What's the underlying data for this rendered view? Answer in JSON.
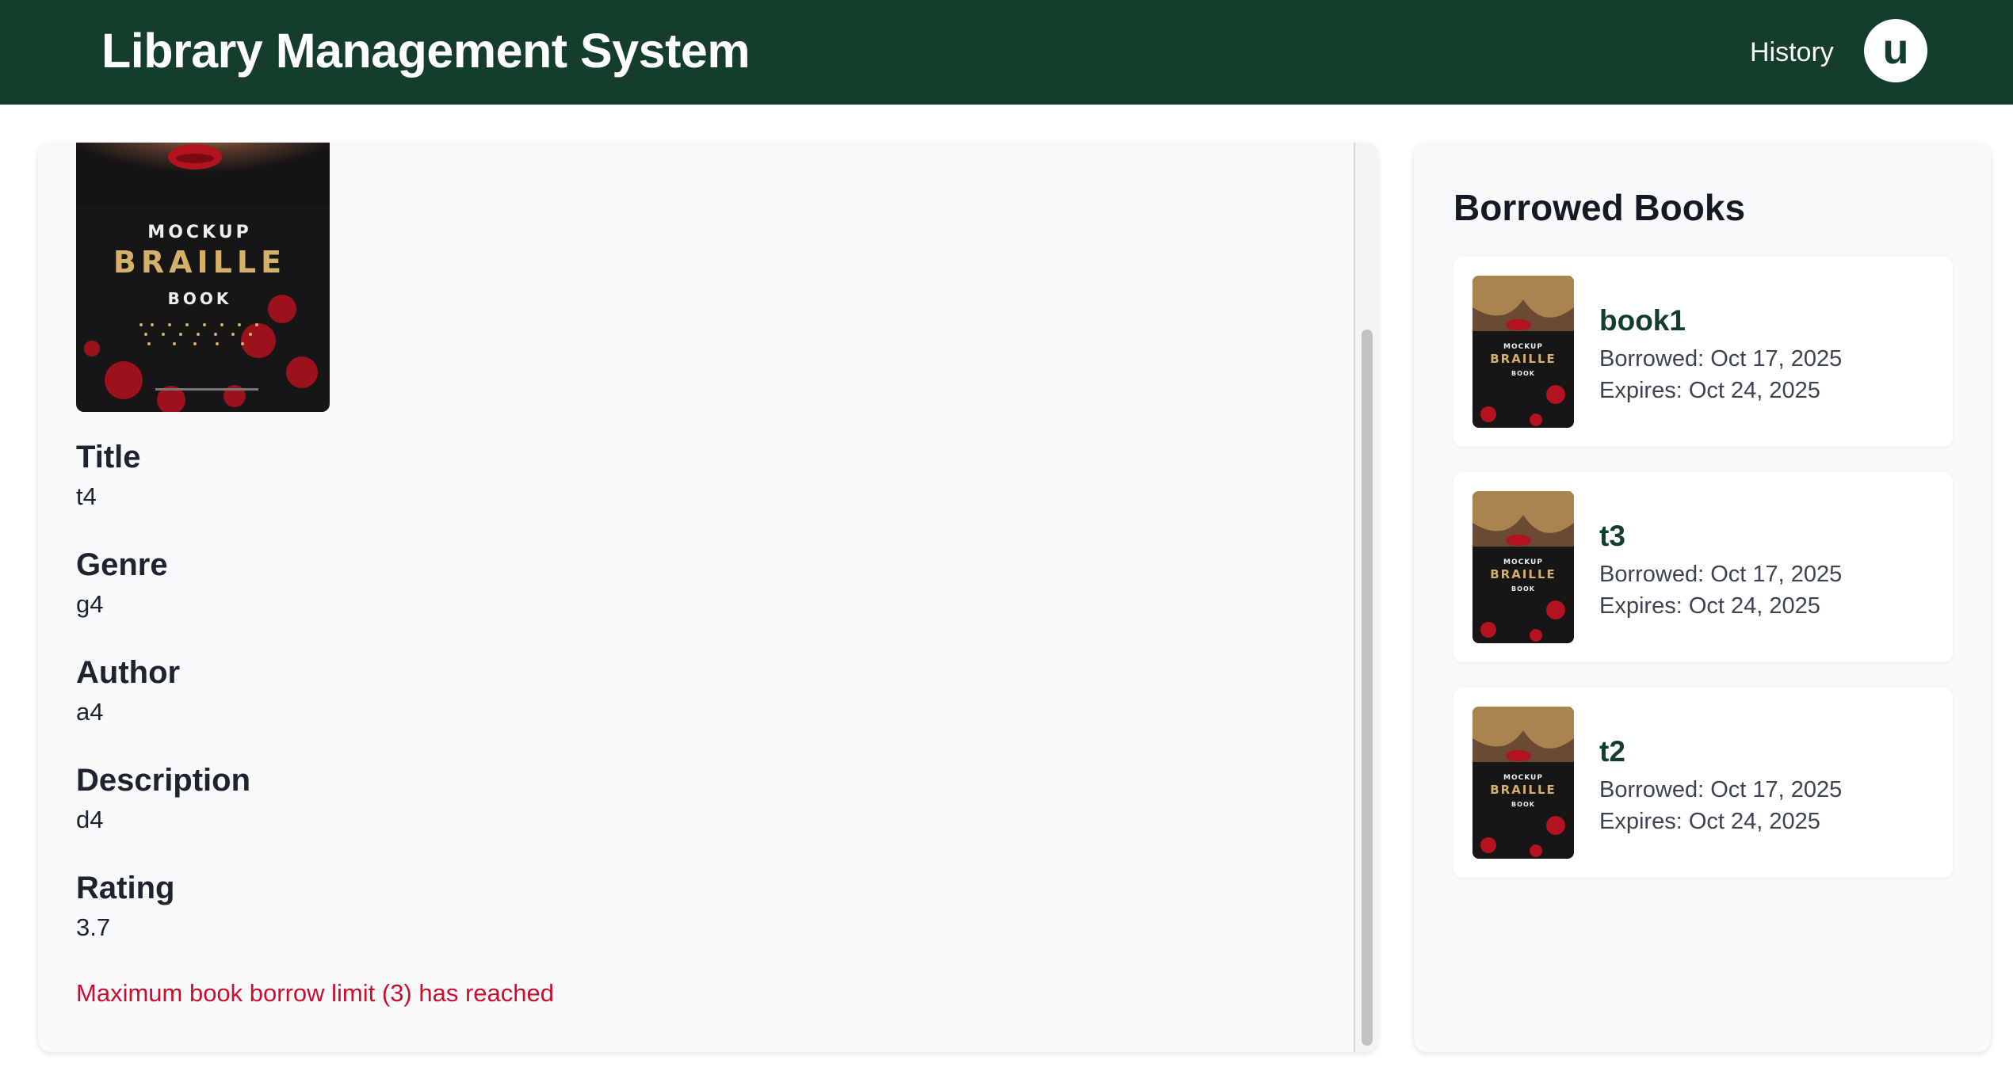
{
  "header": {
    "title": "Library Management System",
    "nav_history": "History",
    "avatar_initial": "u"
  },
  "cover": {
    "line1": "MOCKUP",
    "line2": "BRAILLE",
    "line3": "BOOK"
  },
  "book_detail": {
    "fields": [
      {
        "label": "Title",
        "value": "t4"
      },
      {
        "label": "Genre",
        "value": "g4"
      },
      {
        "label": "Author",
        "value": "a4"
      },
      {
        "label": "Description",
        "value": "d4"
      },
      {
        "label": "Rating",
        "value": "3.7"
      }
    ],
    "error": "Maximum book borrow limit (3) has reached"
  },
  "borrowed": {
    "heading": "Borrowed Books",
    "books": [
      {
        "title": "book1",
        "borrowed": "Borrowed: Oct 17, 2025",
        "expires": "Expires: Oct 24, 2025"
      },
      {
        "title": "t3",
        "borrowed": "Borrowed: Oct 17, 2025",
        "expires": "Expires: Oct 24, 2025"
      },
      {
        "title": "t2",
        "borrowed": "Borrowed: Oct 17, 2025",
        "expires": "Expires: Oct 24, 2025"
      }
    ]
  },
  "colors": {
    "header_bg": "#143d2b",
    "accent_green": "#143d2b",
    "error_red": "#c8102e"
  }
}
